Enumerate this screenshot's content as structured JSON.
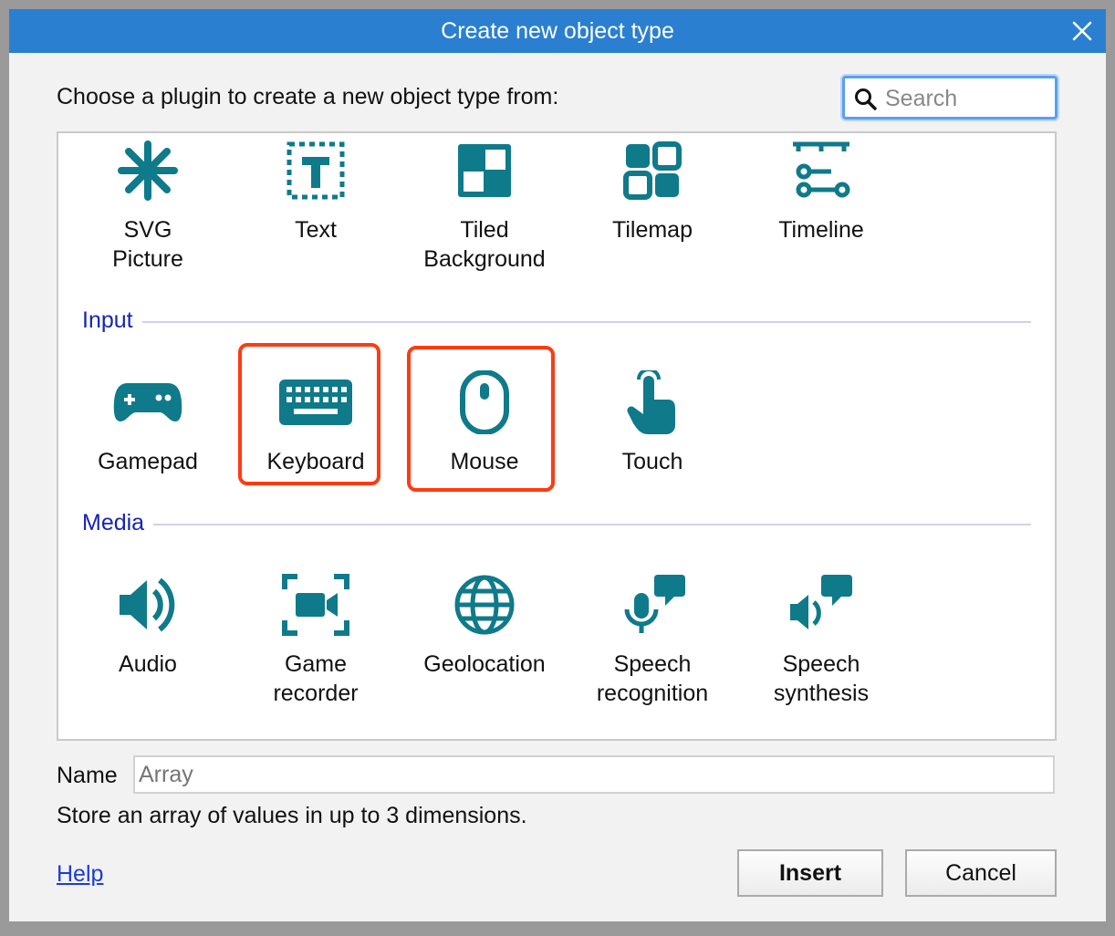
{
  "dialog": {
    "title": "Create new object type",
    "prompt": "Choose a plugin to create a new object type from:",
    "search_placeholder": "Search",
    "name_label": "Name",
    "name_value": "Array",
    "description": "Store an array of values in up to 3 dimensions.",
    "help_label": "Help",
    "insert_label": "Insert",
    "cancel_label": "Cancel"
  },
  "top_items": [
    {
      "label": "SVG\nPicture",
      "icon": "asterisk-icon"
    },
    {
      "label": "Text",
      "icon": "text-box-icon"
    },
    {
      "label": "Tiled\nBackground",
      "icon": "tiles-icon"
    },
    {
      "label": "Tilemap",
      "icon": "grid-icon"
    },
    {
      "label": "Timeline",
      "icon": "timeline-icon"
    }
  ],
  "sections": [
    {
      "name": "Input",
      "items": [
        {
          "label": "Gamepad",
          "icon": "gamepad-icon"
        },
        {
          "label": "Keyboard",
          "icon": "keyboard-icon"
        },
        {
          "label": "Mouse",
          "icon": "mouse-icon"
        },
        {
          "label": "Touch",
          "icon": "touch-icon"
        }
      ]
    },
    {
      "name": "Media",
      "items": [
        {
          "label": "Audio",
          "icon": "speaker-icon"
        },
        {
          "label": "Game\nrecorder",
          "icon": "video-recorder-icon"
        },
        {
          "label": "Geolocation",
          "icon": "globe-icon"
        },
        {
          "label": "Speech\nrecognition",
          "icon": "microphone-icon"
        },
        {
          "label": "Speech\nsynthesis",
          "icon": "speech-speaker-icon"
        }
      ]
    }
  ],
  "colors": {
    "titlebar": "#2b7fd0",
    "icon": "#0f7a8a",
    "section": "#1524b8",
    "highlight": "#ff3b12"
  }
}
